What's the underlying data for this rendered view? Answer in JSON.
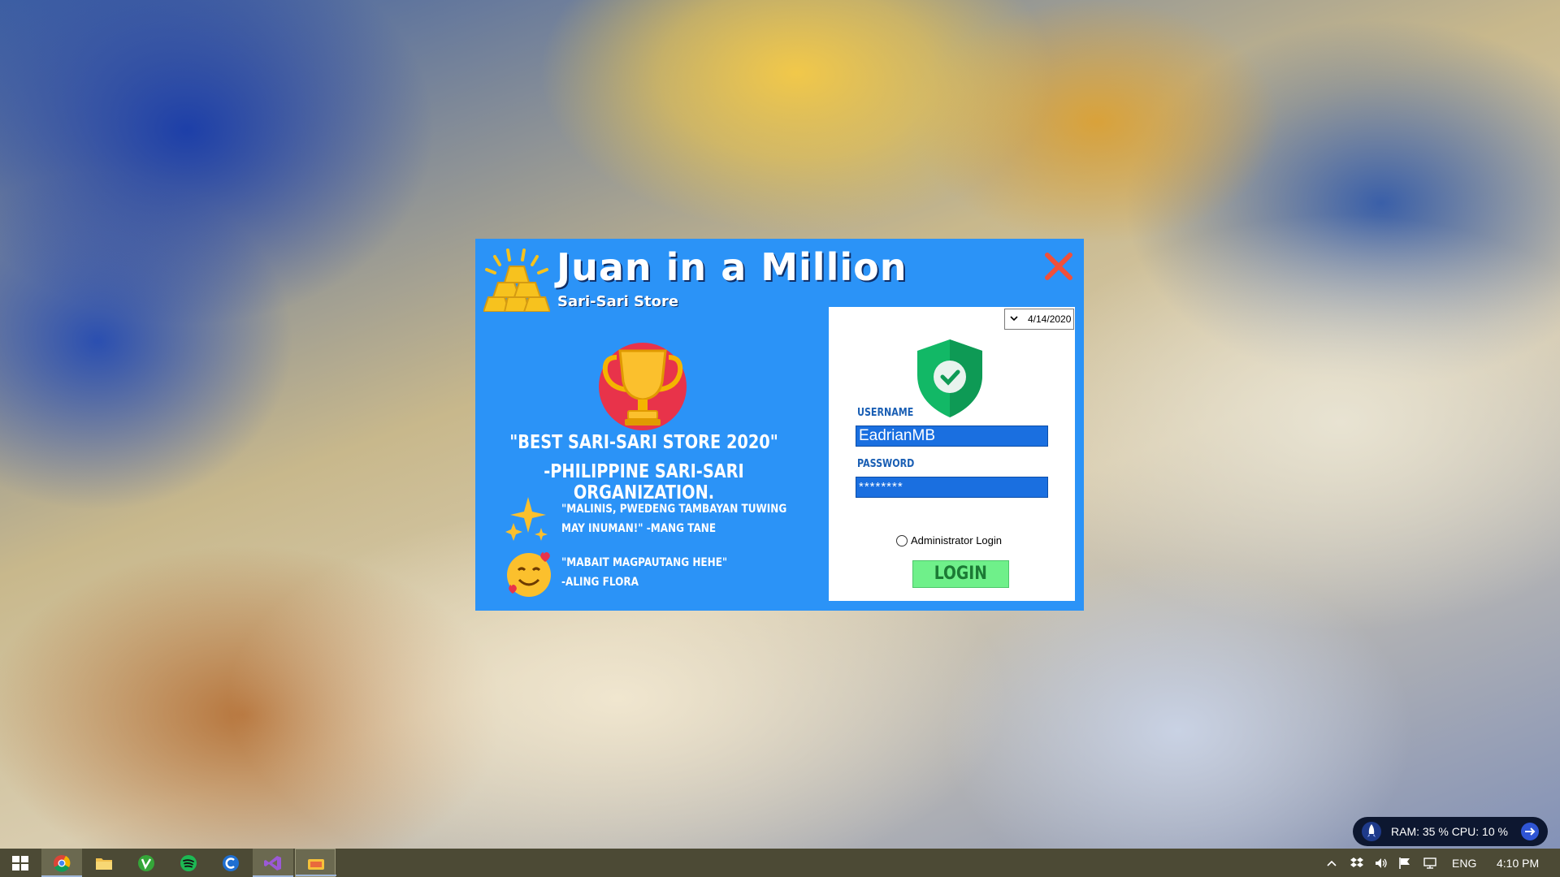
{
  "login_window": {
    "app_title": "Juan in a Million",
    "app_subtitle": "Sari-Sari Store",
    "award_line_1": "\"BEST SARI-SARI STORE 2020\"",
    "award_line_2": "-PHILIPPINE SARI-SARI ORGANIZATION.",
    "testimonials": [
      {
        "line1": "\"MALINIS, PWEDENG TAMBAYAN TUWING",
        "line2": "MAY INUMAN!\"  -MANG TANE",
        "icon": "sparkles-icon"
      },
      {
        "line1": "\"MABAIT MAGPAUTANG HEHE\"",
        "line2": "-ALING FLORA",
        "icon": "smiling-face-hearts-icon"
      }
    ],
    "date_value": "4/14/2020",
    "username_label": "USERNAME",
    "username_value": "EadrianMB",
    "password_label": "PASSWORD",
    "password_value": "********",
    "admin_login_label": "Administrator Login",
    "login_button": "LOGIN",
    "colors": {
      "panel_blue": "#2b93f7",
      "field_blue": "#1a6fe0",
      "login_green": "#6ff08a",
      "close_red": "#f0503a"
    }
  },
  "system_monitor": {
    "text": "RAM: 35 %  CPU: 10 %"
  },
  "taskbar": {
    "apps": [
      "windows-start-icon",
      "chrome-icon",
      "file-explorer-icon",
      "vuze-icon",
      "spotify-icon",
      "ccleaner-icon",
      "visual-studio-icon",
      "sari-sari-app-icon"
    ],
    "language": "ENG",
    "time": "4:10 PM"
  }
}
